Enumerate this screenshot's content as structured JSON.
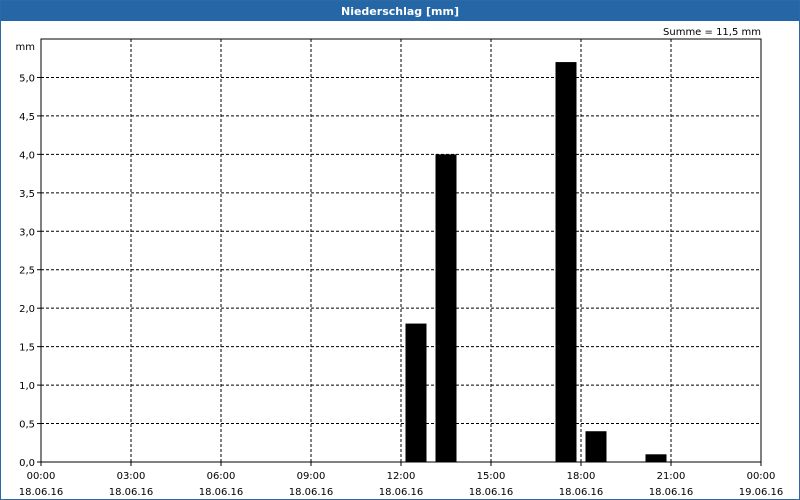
{
  "window": {
    "title": "Niederschlag [mm]"
  },
  "chart_data": {
    "type": "bar",
    "title": "Niederschlag [mm]",
    "ylabel": "mm",
    "annotation": "Summe = 11,5 mm",
    "ylim": [
      0,
      5.5
    ],
    "yticks": [
      {
        "value": 0.0,
        "label": "0,0"
      },
      {
        "value": 0.5,
        "label": "0,5"
      },
      {
        "value": 1.0,
        "label": "1,0"
      },
      {
        "value": 1.5,
        "label": "1,5"
      },
      {
        "value": 2.0,
        "label": "2,0"
      },
      {
        "value": 2.5,
        "label": "2,5"
      },
      {
        "value": 3.0,
        "label": "3,0"
      },
      {
        "value": 3.5,
        "label": "3,5"
      },
      {
        "value": 4.0,
        "label": "4,0"
      },
      {
        "value": 4.5,
        "label": "4,5"
      },
      {
        "value": 5.0,
        "label": "5,0"
      }
    ],
    "xlim_hours": [
      0,
      24
    ],
    "xticks": [
      {
        "hour": 0,
        "time": "00:00",
        "date": "18.06.16"
      },
      {
        "hour": 3,
        "time": "03:00",
        "date": "18.06.16"
      },
      {
        "hour": 6,
        "time": "06:00",
        "date": "18.06.16"
      },
      {
        "hour": 9,
        "time": "09:00",
        "date": "18.06.16"
      },
      {
        "hour": 12,
        "time": "12:00",
        "date": "18.06.16"
      },
      {
        "hour": 15,
        "time": "15:00",
        "date": "18.06.16"
      },
      {
        "hour": 18,
        "time": "18:00",
        "date": "18.06.16"
      },
      {
        "hour": 21,
        "time": "21:00",
        "date": "18.06.16"
      },
      {
        "hour": 24,
        "time": "00:00",
        "date": "19.06.16"
      }
    ],
    "grid": true,
    "bar_color": "#000000",
    "bars": [
      {
        "hour": 12.0,
        "value": 1.8
      },
      {
        "hour": 13.0,
        "value": 4.0
      },
      {
        "hour": 17.0,
        "value": 5.2
      },
      {
        "hour": 18.0,
        "value": 0.4
      },
      {
        "hour": 20.0,
        "value": 0.1
      }
    ]
  }
}
